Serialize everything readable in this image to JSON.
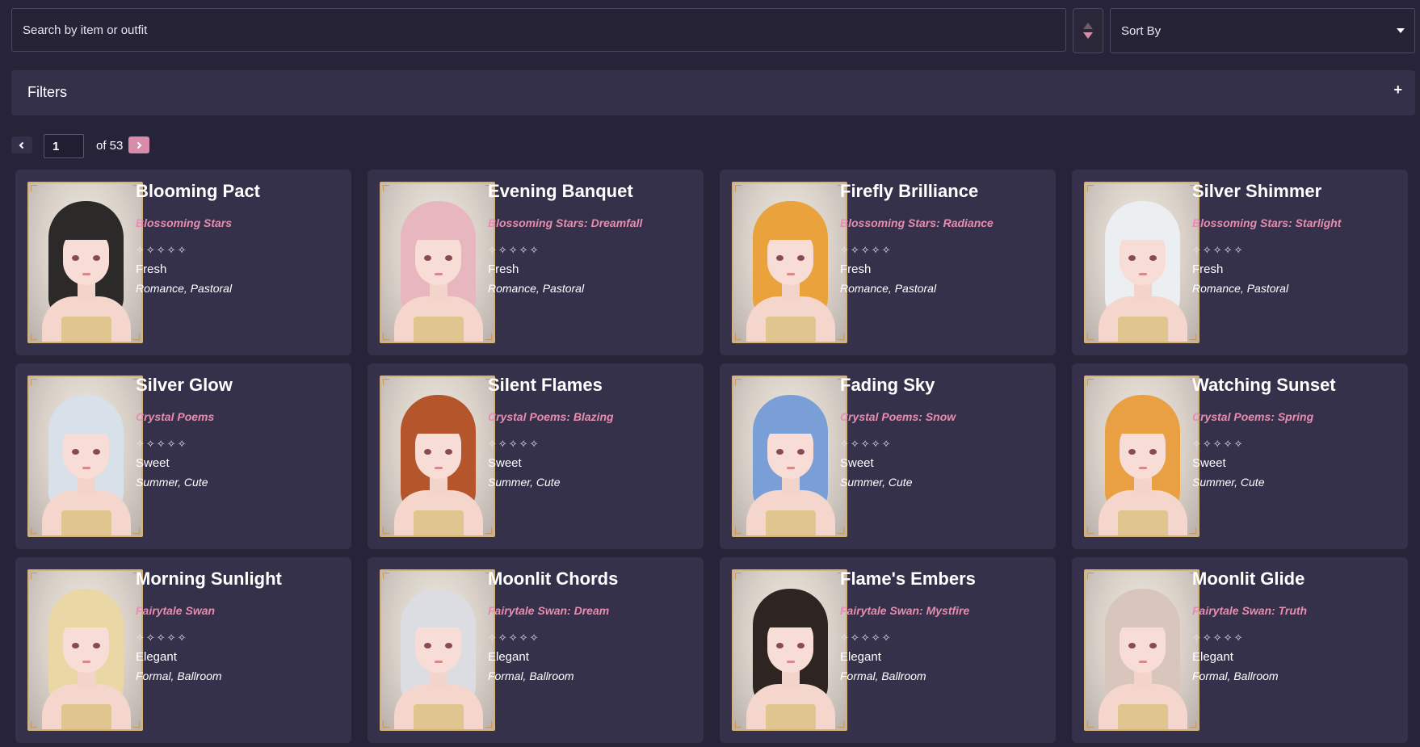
{
  "search": {
    "placeholder": "Search by item or outfit"
  },
  "sort": {
    "label": "Sort By"
  },
  "filters": {
    "title": "Filters",
    "toggle": "+"
  },
  "pager": {
    "current": "1",
    "of_text": "of 53"
  },
  "cards": [
    {
      "name": "Blooming Pact",
      "series": "Blossoming Stars",
      "stars": "✧✧✧✧✧",
      "style": "Fresh",
      "tags": "Romance, Pastoral",
      "hair": "#2c2a29"
    },
    {
      "name": "Evening Banquet",
      "series": "Blossoming Stars: Dreamfall",
      "stars": "✧✧✧✧✧",
      "style": "Fresh",
      "tags": "Romance, Pastoral",
      "hair": "#e8b6bf"
    },
    {
      "name": "Firefly Brilliance",
      "series": "Blossoming Stars: Radiance",
      "stars": "✧✧✧✧✧",
      "style": "Fresh",
      "tags": "Romance, Pastoral",
      "hair": "#e9a23c"
    },
    {
      "name": "Silver Shimmer",
      "series": "Blossoming Stars: Starlight",
      "stars": "✧✧✧✧✧",
      "style": "Fresh",
      "tags": "Romance, Pastoral",
      "hair": "#eceff2"
    },
    {
      "name": "Silver Glow",
      "series": "Crystal Poems",
      "stars": "✧✧✧✧✧",
      "style": "Sweet",
      "tags": "Summer, Cute",
      "hair": "#d8e1ea"
    },
    {
      "name": "Silent Flames",
      "series": "Crystal Poems: Blazing",
      "stars": "✧✧✧✧✧",
      "style": "Sweet",
      "tags": "Summer, Cute",
      "hair": "#b4552c"
    },
    {
      "name": "Fading Sky",
      "series": "Crystal Poems: Snow",
      "stars": "✧✧✧✧✧",
      "style": "Sweet",
      "tags": "Summer, Cute",
      "hair": "#7a9ed6"
    },
    {
      "name": "Watching Sunset",
      "series": "Crystal Poems: Spring",
      "stars": "✧✧✧✧✧",
      "style": "Sweet",
      "tags": "Summer, Cute",
      "hair": "#e9a043"
    },
    {
      "name": "Morning Sunlight",
      "series": "Fairytale Swan",
      "stars": "✧✧✧✧✧",
      "style": "Elegant",
      "tags": "Formal, Ballroom",
      "hair": "#ead7a6"
    },
    {
      "name": "Moonlit Chords",
      "series": "Fairytale Swan: Dream",
      "stars": "✧✧✧✧✧",
      "style": "Elegant",
      "tags": "Formal, Ballroom",
      "hair": "#dcdde2"
    },
    {
      "name": "Flame's Embers",
      "series": "Fairytale Swan: Mystfire",
      "stars": "✧✧✧✧✧",
      "style": "Elegant",
      "tags": "Formal, Ballroom",
      "hair": "#2e2422"
    },
    {
      "name": "Moonlit Glide",
      "series": "Fairytale Swan: Truth",
      "stars": "✧✧✧✧✧",
      "style": "Elegant",
      "tags": "Formal, Ballroom",
      "hair": "#d8c6bd"
    }
  ]
}
